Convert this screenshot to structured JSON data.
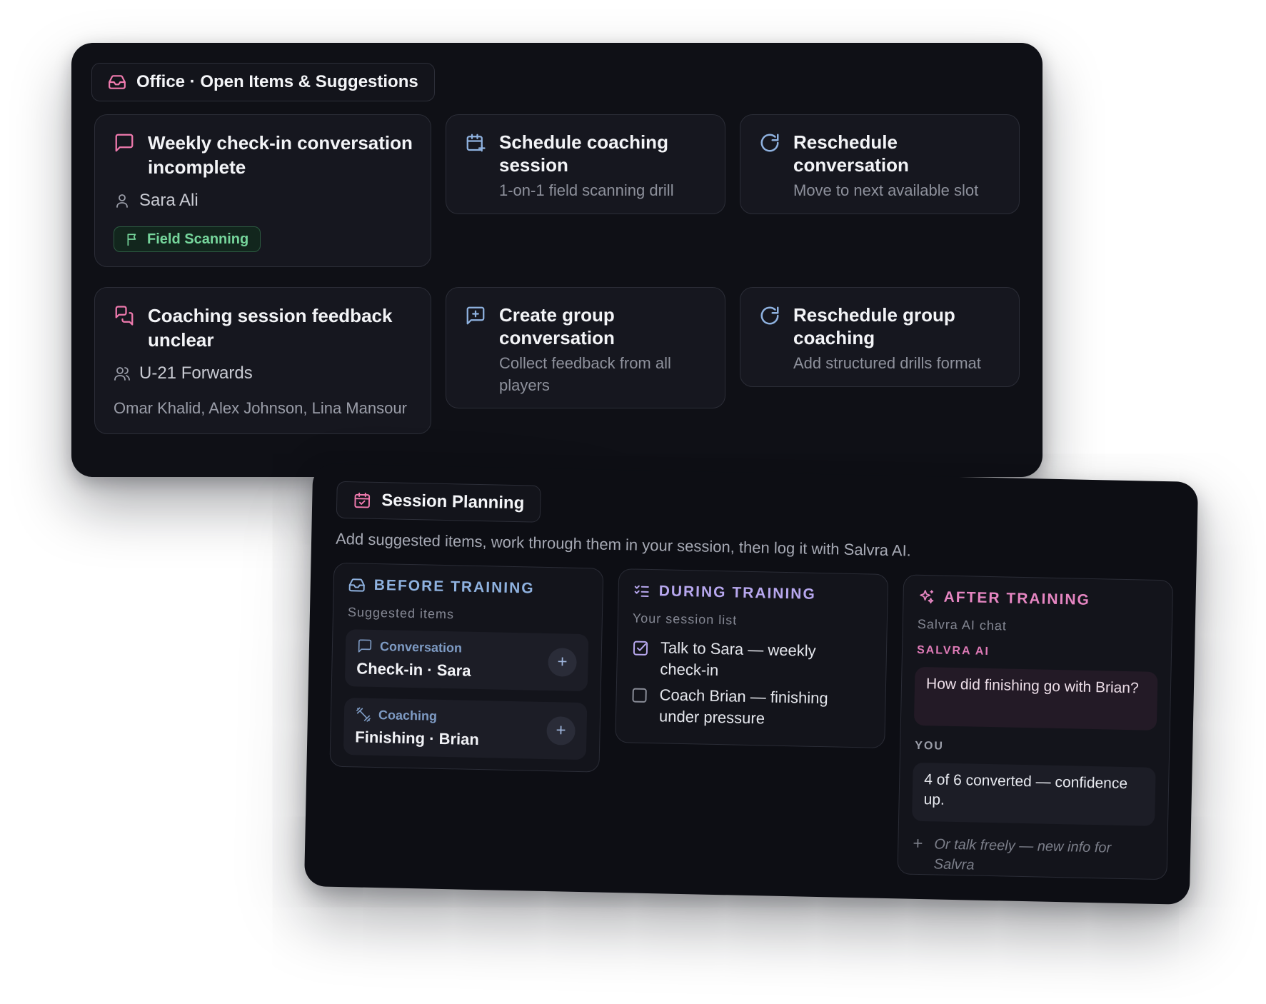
{
  "office": {
    "title": "Office · Open Items & Suggestions",
    "cards": [
      {
        "title": "Weekly check-in conversation incomplete",
        "person": "Sara Ali",
        "tag": "Field Scanning"
      },
      {
        "title": "Schedule coaching session",
        "subtitle": "1-on-1 field scanning drill"
      },
      {
        "title": "Reschedule conversation",
        "subtitle": "Move to next available slot"
      },
      {
        "title": "Coaching session feedback unclear",
        "group": "U-21 Forwards",
        "members": "Omar Khalid, Alex Johnson, Lina Mansour"
      },
      {
        "title": "Create group conversation",
        "subtitle": "Collect feedback from all players"
      },
      {
        "title": "Reschedule group coaching",
        "subtitle": "Add structured drills format"
      }
    ]
  },
  "session": {
    "title": "Session Planning",
    "description": "Add suggested items, work through them in your session, then log it with Salvra AI.",
    "before": {
      "heading": "BEFORE TRAINING",
      "subheading": "Suggested items",
      "items": [
        {
          "kind": "Conversation",
          "name": "Check-in · Sara"
        },
        {
          "kind": "Coaching",
          "name": "Finishing · Brian"
        }
      ]
    },
    "during": {
      "heading": "DURING TRAINING",
      "subheading": "Your session list",
      "tasks": [
        {
          "text": "Talk to Sara — weekly check-in",
          "done": true
        },
        {
          "text": "Coach Brian — finishing under pressure",
          "done": false
        }
      ]
    },
    "after": {
      "heading": "AFTER TRAINING",
      "subheading": "Salvra AI chat",
      "ai_label": "SALVRA AI",
      "ai_message": "How did finishing go with Brian?",
      "you_label": "YOU",
      "you_message": "4 of 6 converted — confidence up.",
      "free_prompt": "Or talk freely — new info for Salvra"
    }
  },
  "colors": {
    "before_accent": "#8FB2E0",
    "during_accent": "#B7A7EE",
    "after_accent": "#E686C2",
    "tag_green": "#76D69C"
  }
}
